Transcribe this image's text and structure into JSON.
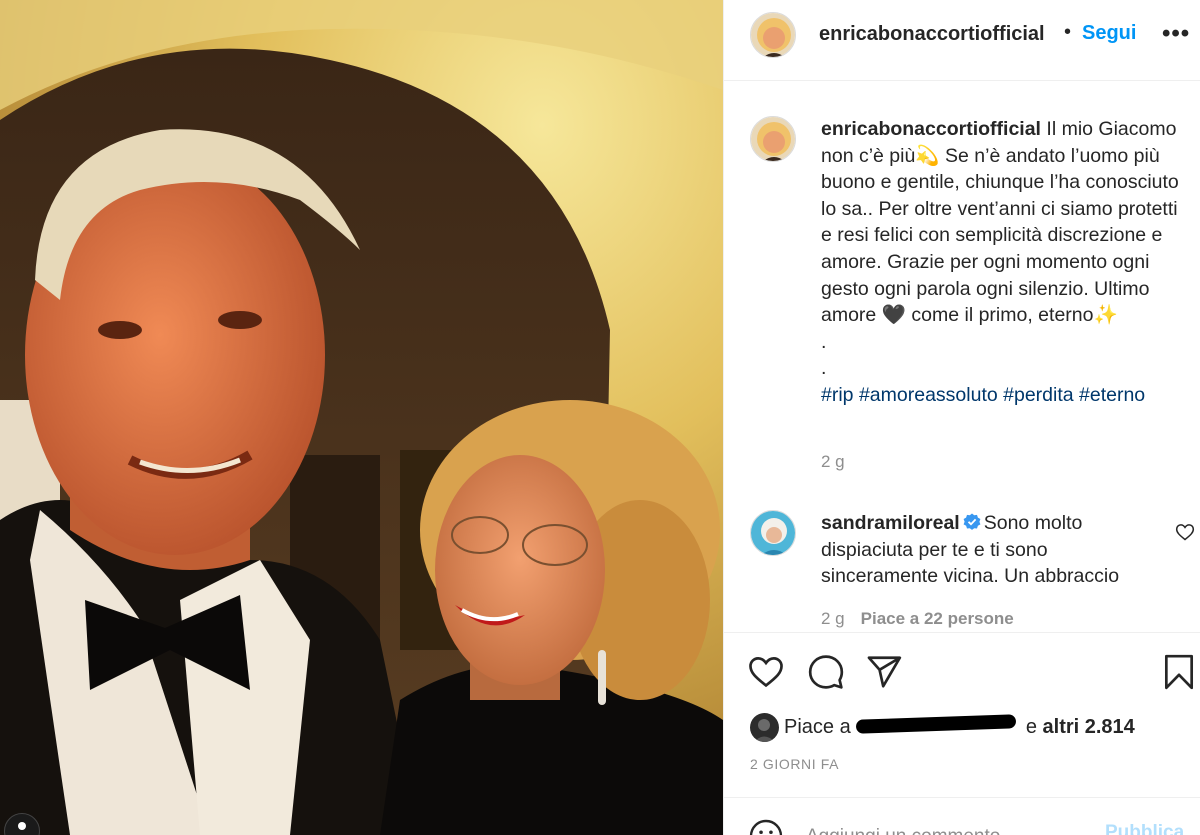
{
  "post": {
    "author": "enricabonaccortiofficial",
    "separator": "•",
    "follow_label": "Segui",
    "more_label": "•••"
  },
  "caption": {
    "user": "enricabonaccortiofficial",
    "text_part1": "Il mio Giacomo non c’è più",
    "emoji_dizzy": "💫",
    "text_part2": " Se n’è andato l’uomo più buono e gentile, chiunque l’ha conosciuto lo sa.. Per oltre vent’anni ci siamo protetti e resi felici con semplicità discrezione e amore. Grazie per ogni momento ogni gesto ogni parola ogni silenzio. Ultimo amore ",
    "emoji_heart": "🖤",
    "text_part3": " come il primo, eterno",
    "emoji_sparkles": "✨",
    "dot1": ".",
    "dot2": ".",
    "hashtags": [
      "#rip",
      "#amoreassoluto",
      "#perdita",
      "#eterno"
    ],
    "time": "2 g"
  },
  "comment": {
    "user": "sandramiloreal",
    "text": "Sono molto dispiaciuta per te e ti sono sinceramente vicina. Un abbraccio",
    "time": "2 g",
    "likes": "Piace a 22 persone"
  },
  "likes": {
    "prefix": "Piace a ",
    "middle": " e ",
    "others": "altri 2.814"
  },
  "date": "2 GIORNI FA",
  "add_comment": {
    "placeholder": "Aggiungi un commento...",
    "publish_label": "Pubblica"
  },
  "colors": {
    "accent": "#0095f6",
    "link": "#00376b",
    "muted": "#8e8e8e",
    "verified": "#3897f0"
  }
}
